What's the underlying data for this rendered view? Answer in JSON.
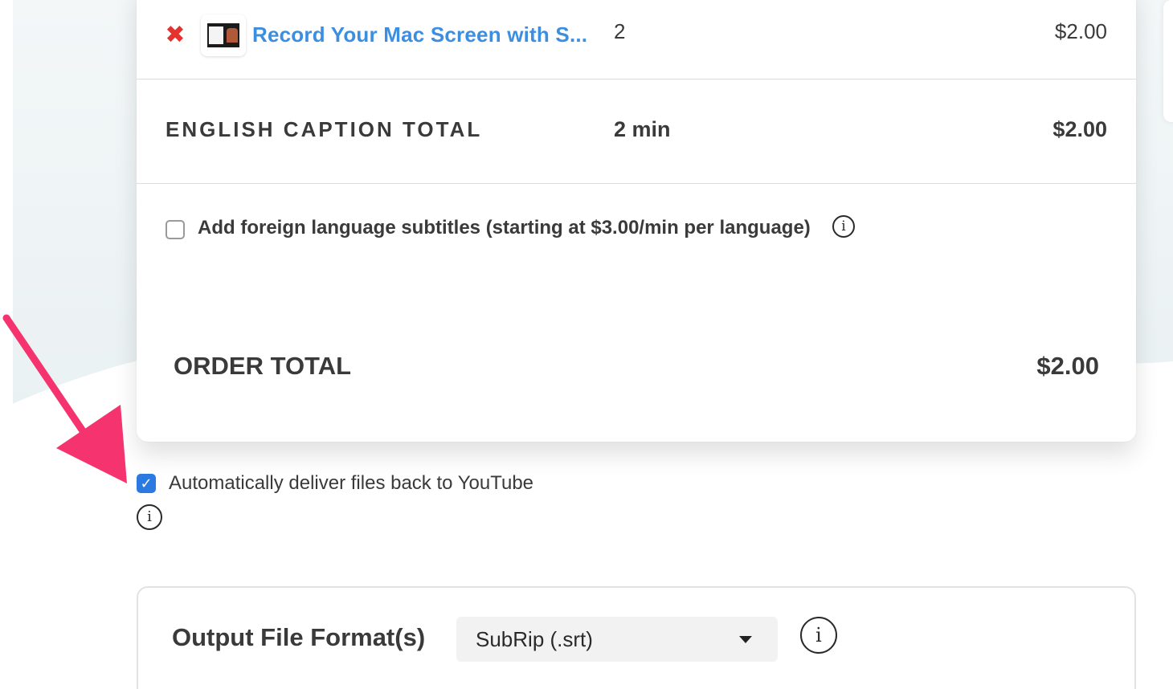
{
  "line_item": {
    "title": "Record Your Mac Screen with S...",
    "quantity": "2",
    "price": "$2.00",
    "remove_icon": "close-x-icon"
  },
  "caption_total": {
    "label": "ENGLISH CAPTION TOTAL",
    "minutes": "2 min",
    "price": "$2.00"
  },
  "foreign_subtitles": {
    "label": "Add foreign language subtitles (starting at $3.00/min per language)",
    "checked": false
  },
  "order_total": {
    "label": "ORDER TOTAL",
    "price": "$2.00"
  },
  "youtube_delivery": {
    "label": "Automatically deliver files back to YouTube",
    "checked": true
  },
  "output_format": {
    "label": "Output File Format(s)",
    "selected": "SubRip (.srt)"
  },
  "colors": {
    "link_blue": "#3b8ee0",
    "remove_red": "#e5322d",
    "checkbox_blue": "#2a7ae2",
    "annotation_pink": "#f4336f"
  }
}
